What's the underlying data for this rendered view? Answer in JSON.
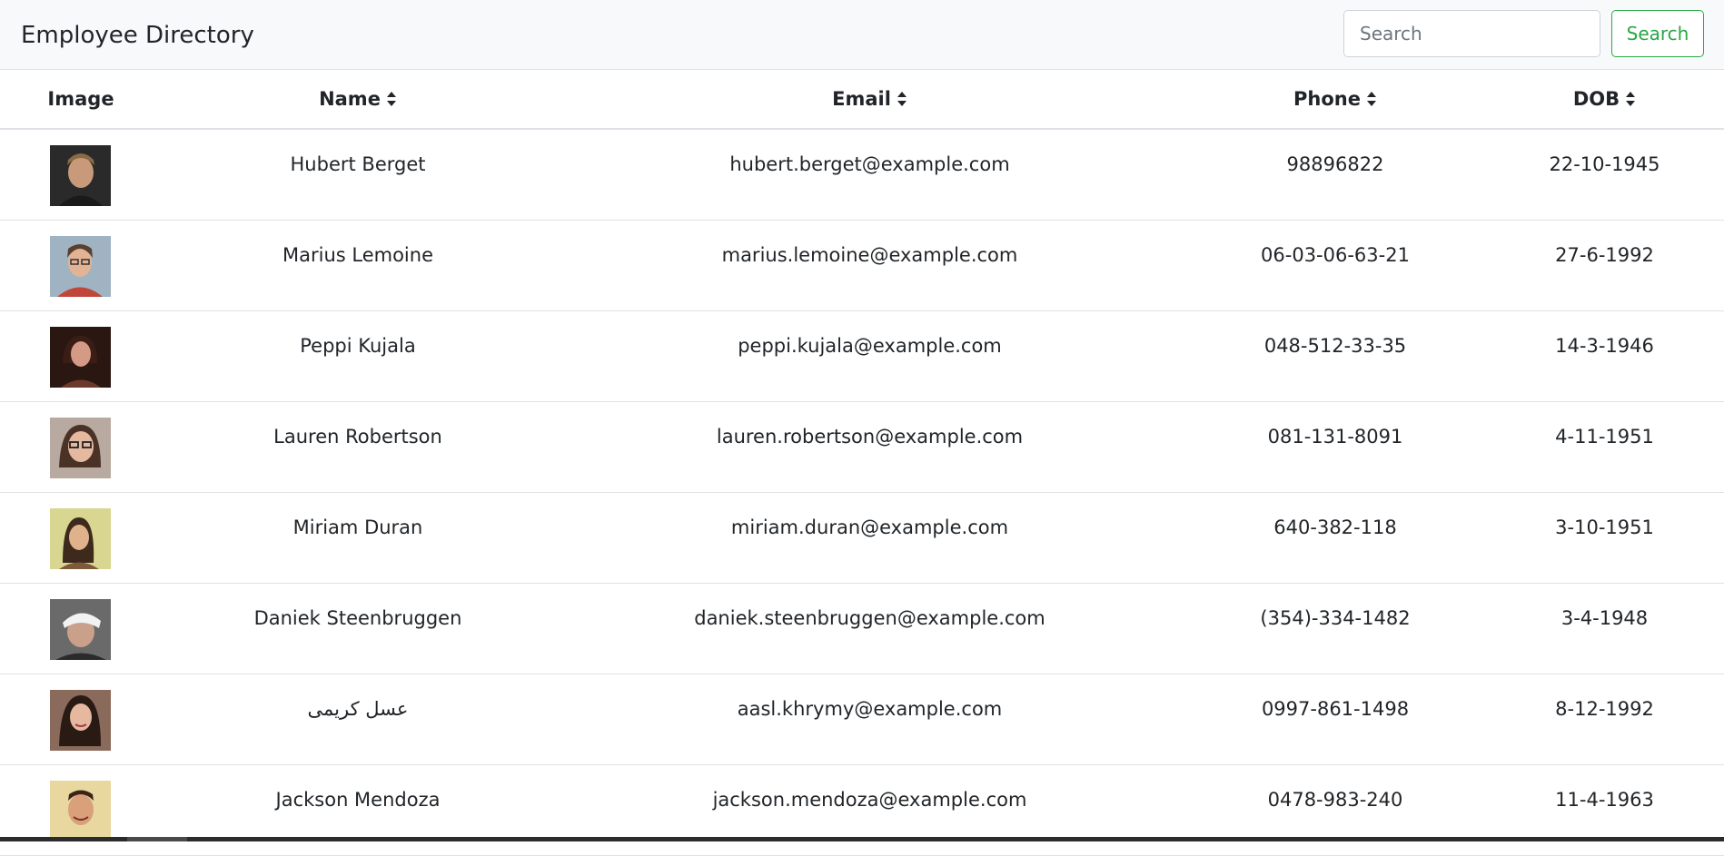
{
  "header": {
    "title": "Employee Directory",
    "search_placeholder": "Search",
    "search_button_label": "Search"
  },
  "table": {
    "columns": {
      "image": "Image",
      "name": "Name",
      "email": "Email",
      "phone": "Phone",
      "dob": "DOB"
    },
    "rows": [
      {
        "name": "Hubert Berget",
        "email": "hubert.berget@example.com",
        "phone": "98896822",
        "dob": "22-10-1945"
      },
      {
        "name": "Marius Lemoine",
        "email": "marius.lemoine@example.com",
        "phone": "06-03-06-63-21",
        "dob": "27-6-1992"
      },
      {
        "name": "Peppi Kujala",
        "email": "peppi.kujala@example.com",
        "phone": "048-512-33-35",
        "dob": "14-3-1946"
      },
      {
        "name": "Lauren Robertson",
        "email": "lauren.robertson@example.com",
        "phone": "081-131-8091",
        "dob": "4-11-1951"
      },
      {
        "name": "Miriam Duran",
        "email": "miriam.duran@example.com",
        "phone": "640-382-118",
        "dob": "3-10-1951"
      },
      {
        "name": "Daniek Steenbruggen",
        "email": "daniek.steenbruggen@example.com",
        "phone": "(354)-334-1482",
        "dob": "3-4-1948"
      },
      {
        "name": "عسل کریمی",
        "email": "aasl.khrymy@example.com",
        "phone": "0997-861-1498",
        "dob": "8-12-1992"
      },
      {
        "name": "Jackson Mendoza",
        "email": "jackson.mendoza@example.com",
        "phone": "0478-983-240",
        "dob": "11-4-1963"
      }
    ]
  },
  "icons": {
    "sort": "sort-icon"
  },
  "colors": {
    "navbar_bg": "#f8f9fa",
    "accent_success": "#28a745",
    "border": "#dee2e6",
    "text": "#212529"
  }
}
